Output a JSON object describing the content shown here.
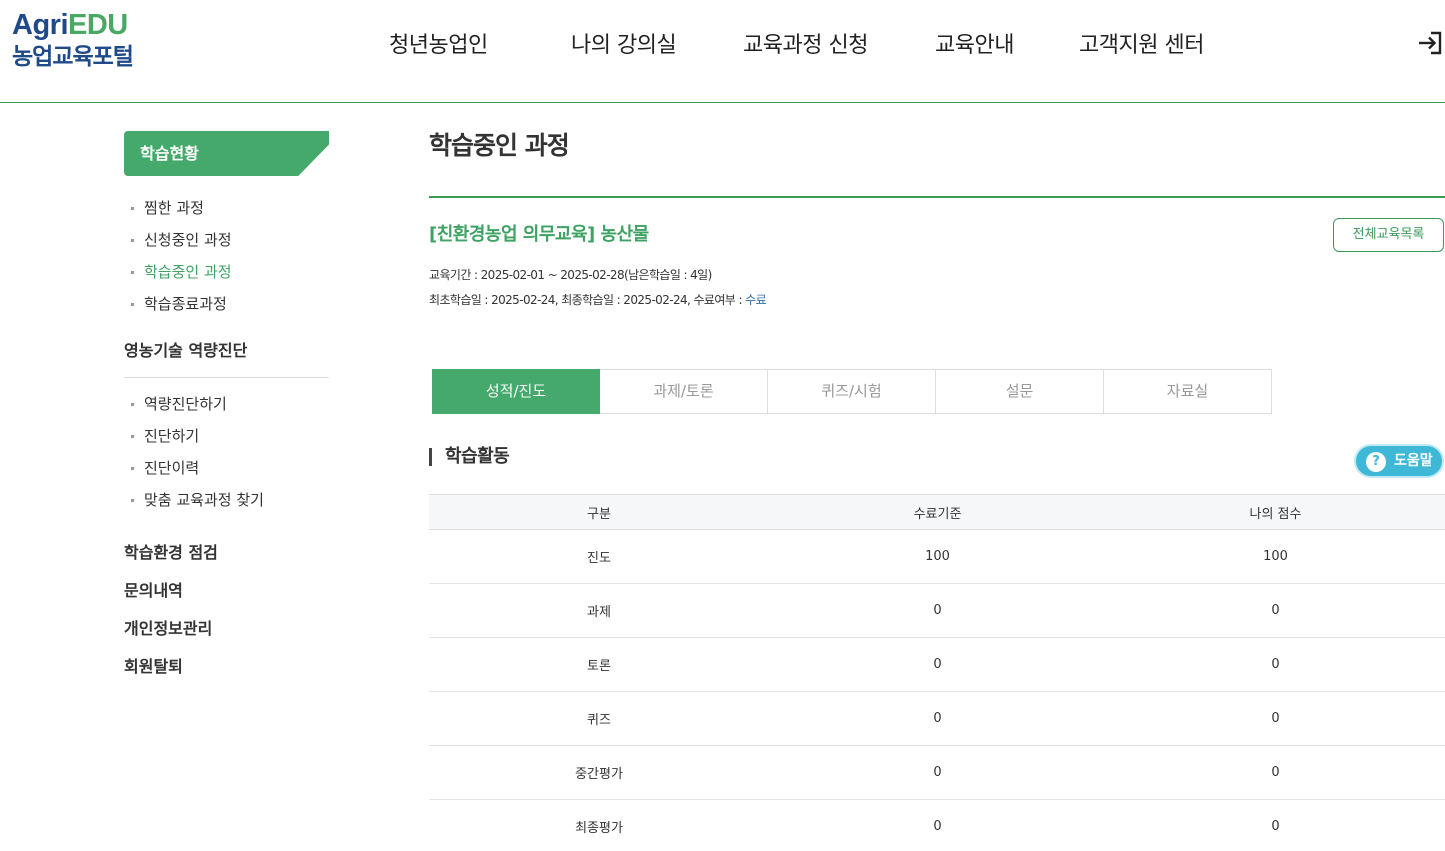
{
  "logo": {
    "brand_a": "Agri",
    "brand_b": "EDU",
    "subtitle": "농업교육포털"
  },
  "gnb": [
    {
      "label": "청년농업인"
    },
    {
      "label": "나의 강의실"
    },
    {
      "label": "교육과정 신청"
    },
    {
      "label": "교육안내"
    },
    {
      "label": "고객지원 센터"
    }
  ],
  "header": {
    "login_icon": "login-icon"
  },
  "sidebar": {
    "head": "학습현황",
    "learning_items": [
      {
        "label": "찜한 과정"
      },
      {
        "label": "신청중인 과정"
      },
      {
        "label": "학습중인 과정"
      },
      {
        "label": "학습종료과정"
      }
    ],
    "diagnosis_title": "영농기술 역량진단",
    "diagnosis_items": [
      {
        "label": "역량진단하기"
      },
      {
        "label": "진단하기"
      },
      {
        "label": "진단이력"
      },
      {
        "label": "맞춤 교육과정 찾기"
      }
    ],
    "groups": [
      {
        "label": "학습환경 점검"
      },
      {
        "label": "문의내역"
      },
      {
        "label": "개인정보관리"
      },
      {
        "label": "회원탈퇴"
      }
    ]
  },
  "main": {
    "page_title": "학습중인 과정",
    "course_title": "[친환경농업 의무교육] 농산물",
    "list_button": "전체교육목록",
    "info_line1": "교육기간 : 2025-02-01 ~ 2025-02-28(남은학습일 : 4일)",
    "info_line2_prefix": "최초학습일 : 2025-02-24, 최종학습일 : 2025-02-24, 수료여부 : ",
    "info_line2_status": "수료",
    "tabs": [
      {
        "label": "성적/진도"
      },
      {
        "label": "과제/토론"
      },
      {
        "label": "퀴즈/시험"
      },
      {
        "label": "설문"
      },
      {
        "label": "자료실"
      }
    ],
    "section_title": "학습활동",
    "help_button": "도움말",
    "help_icon_glyph": "?"
  },
  "table": {
    "headers": [
      "구분",
      "수료기준",
      "나의 점수"
    ],
    "rows": [
      [
        "진도",
        "100",
        "100"
      ],
      [
        "과제",
        "0",
        "0"
      ],
      [
        "토론",
        "0",
        "0"
      ],
      [
        "퀴즈",
        "0",
        "0"
      ],
      [
        "중간평가",
        "0",
        "0"
      ],
      [
        "최종평가",
        "0",
        "0"
      ]
    ]
  },
  "colors": {
    "brand_green": "#44a96a",
    "brand_blue": "#1f4a8a",
    "help_blue": "#3fb8d8",
    "status_blue": "#2e6fb2"
  }
}
